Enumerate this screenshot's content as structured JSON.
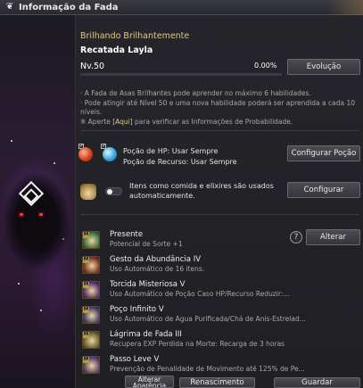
{
  "window": {
    "title": "Informação da Fada",
    "title_icon": "butterfly-icon"
  },
  "fairy": {
    "grade": "Brilhando Brilhantemente",
    "name": "Recatada Layla",
    "level": "Nv.50",
    "exp_percent": "0.00%",
    "exp_fraction": 0.0
  },
  "buttons": {
    "evolution": "Evolução",
    "configure_potion": "Configurar Poção",
    "configure": "Configurar",
    "change": "Alterar",
    "change_appearance": "Alterar Aparência",
    "rebirth": "Renascimento",
    "save": "Guardar"
  },
  "info": {
    "line1": "· A Fada de Asas Brilhantes pode aprender no máximo 6 habilidades.",
    "line2": "· Pode atingir até Nível 50 e uma nova habilidade poderá ser aprendida a cada 10 níveis.",
    "line3_prefix": "※ Aperte ",
    "line3_link": "[Aqui]",
    "line3_suffix": " para verificar as Informações de Probabilidade."
  },
  "potions": {
    "hp": "Poção de HP: Usar Sempre",
    "mp": "Poção de Recurso: Usar Sempre",
    "hp_checked": "✓",
    "mp_checked": "✓"
  },
  "auto_use": {
    "text": "Itens como comida e elixires são usados automaticamente.",
    "enabled": false
  },
  "skills": [
    {
      "name": "Presente",
      "desc": "Potencial de Sorte +1",
      "badge": "M",
      "icon": "gift-icon",
      "color": "#3e6b3a"
    },
    {
      "name": "Gesto da Abundância IV",
      "desc": "Uso Automático de 16 itens.",
      "badge": "M",
      "icon": "abundance-icon",
      "color": "#7a3020"
    },
    {
      "name": "Torcida Misteriosa V",
      "desc": "Uso Automático de Poção Caso HP/Recurso Reduzir:...",
      "badge": "M",
      "icon": "potion-cheer-icon",
      "color": "#5a2c6a"
    },
    {
      "name": "Poço Infinito V",
      "desc": "Uso Automático de Água Purificada/Chá de Anis-Estrelad...",
      "badge": "M",
      "icon": "well-icon",
      "color": "#4a3a6a"
    },
    {
      "name": "Lágrima de Fada III",
      "desc": "Recupera EXP Perdida na Morte: Recarga de 3 horas",
      "badge": "M",
      "icon": "fairy-tear-icon",
      "color": "#6a5a2a"
    },
    {
      "name": "Passo Leve V",
      "desc": "Prevenção de Penalidade de Movimento até 125% de Pe...",
      "badge": "M",
      "icon": "light-step-icon",
      "color": "#5a3a6a"
    }
  ],
  "help_label": "?"
}
